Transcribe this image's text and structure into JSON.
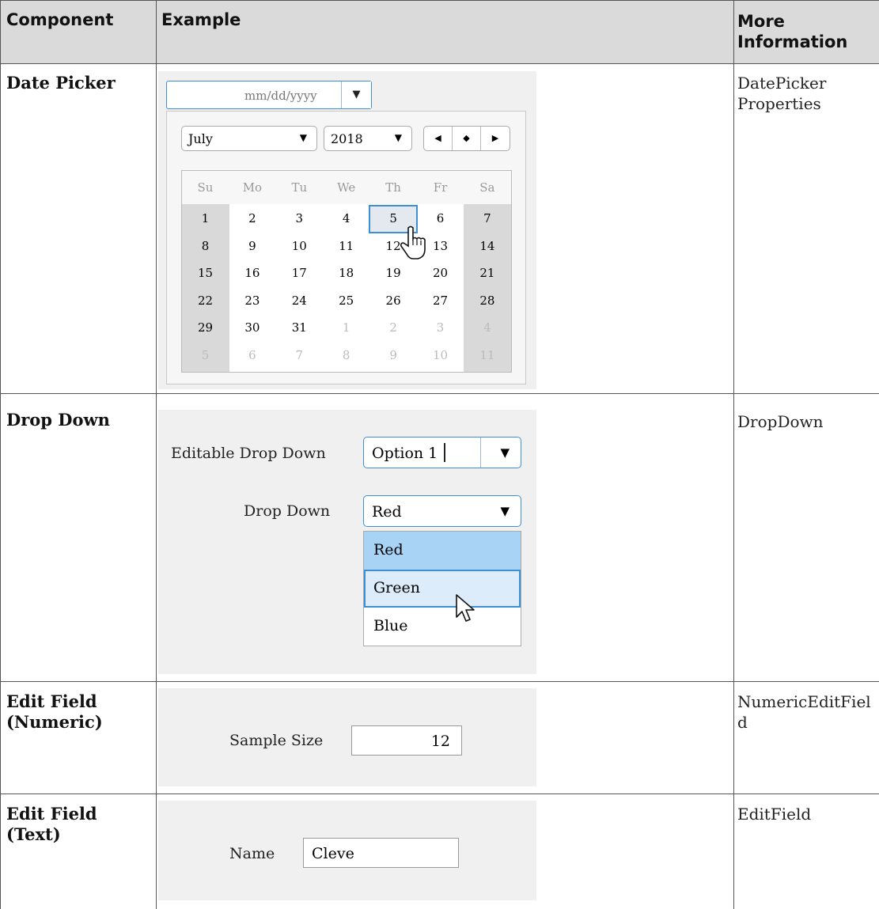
{
  "table": {
    "headers": {
      "component": "Component",
      "example": "Example",
      "more_information": "More Information"
    },
    "rows": [
      {
        "component": "Date Picker",
        "more_information": "DatePicker Properties"
      },
      {
        "component": "Drop Down",
        "more_information": "DropDown"
      },
      {
        "component": "Edit Field (Numeric)",
        "more_information": "NumericEditField"
      },
      {
        "component": "Edit Field (Text)",
        "more_information": "EditField"
      }
    ]
  },
  "date_picker": {
    "placeholder": "mm/dd/yyyy",
    "month": "July",
    "year": "2018",
    "day_names": [
      "Su",
      "Mo",
      "Tu",
      "We",
      "Th",
      "Fr",
      "Sa"
    ],
    "weeks": [
      [
        "1",
        "2",
        "3",
        "4",
        "5",
        "6",
        "7"
      ],
      [
        "8",
        "9",
        "10",
        "11",
        "12",
        "13",
        "14"
      ],
      [
        "15",
        "16",
        "17",
        "18",
        "19",
        "20",
        "21"
      ],
      [
        "22",
        "23",
        "24",
        "25",
        "26",
        "27",
        "28"
      ],
      [
        "29",
        "30",
        "31",
        "1",
        "2",
        "3",
        "4"
      ],
      [
        "5",
        "6",
        "7",
        "8",
        "9",
        "10",
        "11"
      ]
    ],
    "highlighted_day": "5",
    "accent_color": "#3d8fd6"
  },
  "drop_down": {
    "editable_label": "Editable Drop Down",
    "editable_value": "Option 1",
    "label": "Drop Down",
    "selected": "Red",
    "options": [
      "Red",
      "Green",
      "Blue"
    ]
  },
  "numeric_edit_field": {
    "label": "Sample Size",
    "value": "12"
  },
  "text_edit_field": {
    "label": "Name",
    "value": "Cleve"
  },
  "icons": {
    "dropdown_arrow": "▼",
    "nav_prev": "◀",
    "nav_today": "◆",
    "nav_next": "▶"
  }
}
